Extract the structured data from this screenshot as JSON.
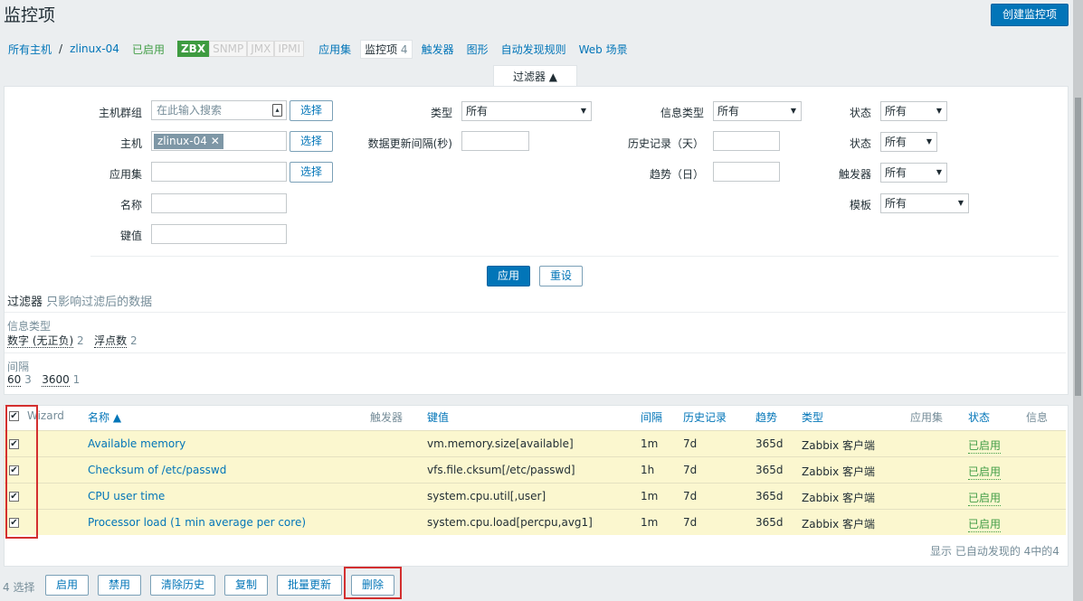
{
  "page_title": "监控项",
  "create_button": "创建监控项",
  "breadcrumbs": {
    "all_hosts": "所有主机",
    "sep": "/",
    "host": "zlinux-04",
    "enabled": "已启用",
    "zbx": "ZBX",
    "snmp": "SNMP",
    "jmx": "JMX",
    "ipmi": "IPMI",
    "applications": "应用集",
    "items": "监控项",
    "items_count": "4",
    "triggers": "触发器",
    "graphs": "图形",
    "discovery": "自动发现规则",
    "web": "Web 场景"
  },
  "filter": {
    "tab_label": "过滤器 ▲",
    "host_group_label": "主机群组",
    "host_group_placeholder": "在此输入搜索",
    "select_label": "选择",
    "host_label": "主机",
    "host_chip": "zlinux-04",
    "app_label": "应用集",
    "name_label": "名称",
    "key_label": "键值",
    "type_label": "类型",
    "type_value": "所有",
    "interval_label": "数据更新间隔(秒)",
    "info_type_label": "信息类型",
    "info_type_value": "所有",
    "history_label": "历史记录（天）",
    "trends_label": "趋势（日）",
    "status_label": "状态",
    "status_value": "所有",
    "state_label": "状态",
    "state_value": "所有",
    "triggers_label": "触发器",
    "triggers_value": "所有",
    "template_label": "模板",
    "template_value": "所有",
    "apply": "应用",
    "reset": "重设"
  },
  "subfilter": {
    "title": "过滤器",
    "note": "只影响过滤后的数据",
    "info_type_title": "信息类型",
    "opt1": "数字 (无正负)",
    "opt1_count": "2",
    "opt2": "浮点数",
    "opt2_count": "2",
    "interval_title": "间隔",
    "iv1": "60",
    "iv1_count": "3",
    "iv2": "3600",
    "iv2_count": "1"
  },
  "table": {
    "headers": {
      "wizard": "Wizard",
      "name": "名称 ▲",
      "triggers": "触发器",
      "key": "键值",
      "interval": "间隔",
      "history": "历史记录",
      "trends": "趋势",
      "type": "类型",
      "apps": "应用集",
      "status": "状态",
      "info": "信息"
    },
    "rows": [
      {
        "name": "Available memory",
        "key": "vm.memory.size[available]",
        "interval": "1m",
        "history": "7d",
        "trends": "365d",
        "type": "Zabbix 客户端",
        "status": "已启用"
      },
      {
        "name": "Checksum of /etc/passwd",
        "key": "vfs.file.cksum[/etc/passwd]",
        "interval": "1h",
        "history": "7d",
        "trends": "365d",
        "type": "Zabbix 客户端",
        "status": "已启用"
      },
      {
        "name": "CPU user time",
        "key": "system.cpu.util[,user]",
        "interval": "1m",
        "history": "7d",
        "trends": "365d",
        "type": "Zabbix 客户端",
        "status": "已启用"
      },
      {
        "name": "Processor load (1 min average per core)",
        "key": "system.cpu.load[percpu,avg1]",
        "interval": "1m",
        "history": "7d",
        "trends": "365d",
        "type": "Zabbix 客户端",
        "status": "已启用"
      }
    ],
    "footer_note": "显示 已自动发现的 4中的4"
  },
  "actions": {
    "selected": "4 选择",
    "enable": "启用",
    "disable": "禁用",
    "clear_history": "清除历史",
    "copy": "复制",
    "mass_update": "批量更新",
    "delete": "删除"
  }
}
